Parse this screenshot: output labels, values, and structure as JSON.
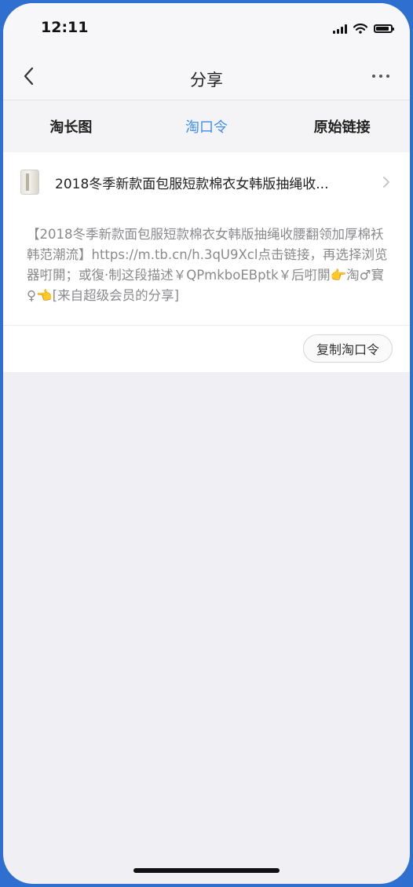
{
  "status": {
    "time": "12:11"
  },
  "nav": {
    "title": "分享",
    "back_icon": "chevron-left-icon",
    "more_icon": "more-icon"
  },
  "tabs": [
    {
      "label": "淘长图",
      "active": false
    },
    {
      "label": "淘口令",
      "active": true
    },
    {
      "label": "原始链接",
      "active": false
    }
  ],
  "product": {
    "title": "2018冬季新款面包服短款棉衣女韩版抽绳收..."
  },
  "description": "【2018冬季新款面包服短款棉衣女韩版抽绳收腰翻领加厚棉袄韩范潮流】https://m.tb.cn/h.3qU9Xcl点击链接，再选择浏览器咑閞；或復·制这段描述￥QPmkboEBptk￥后咑閞👉淘♂寳♀👈[来自超级会员的分享]",
  "actions": {
    "copy_label": "复制淘口令"
  },
  "colors": {
    "accent": "#3d8ef0",
    "background": "#efeff4",
    "frame": "#2f6fd0"
  }
}
